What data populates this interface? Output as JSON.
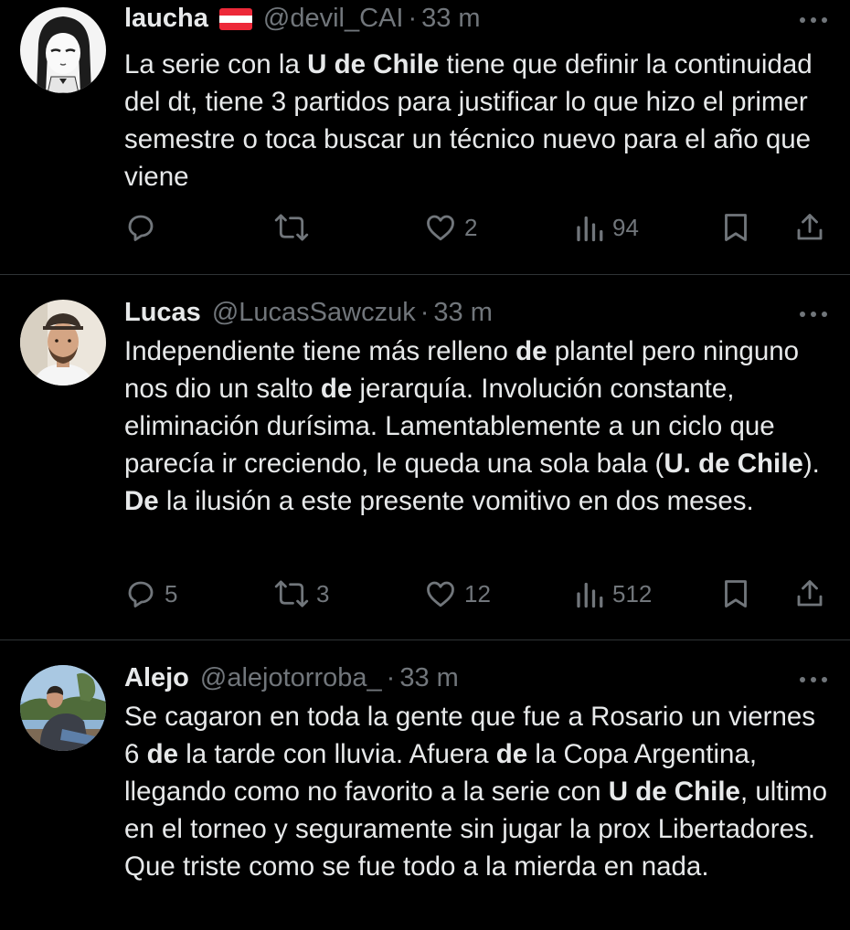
{
  "tweets": [
    {
      "display_name": "laucha",
      "flag": "austria-flag",
      "handle": "@devil_CAI",
      "dot": "·",
      "time": "33 m",
      "body": [
        {
          "t": "La serie con la "
        },
        {
          "t": "U de Chile",
          "b": true
        },
        {
          "t": " tiene que definir la continuidad del dt, tiene 3 partidos para justificar lo que hizo el primer semestre o toca buscar un técnico nuevo para el año que viene"
        }
      ],
      "replies": "",
      "retweets": "",
      "likes": "2",
      "views": "94"
    },
    {
      "display_name": "Lucas",
      "handle": "@LucasSawczuk",
      "dot": "·",
      "time": "33 m",
      "body": [
        {
          "t": "Independiente tiene más relleno "
        },
        {
          "t": "de",
          "b": true
        },
        {
          "t": " plantel pero ninguno nos dio un salto "
        },
        {
          "t": "de",
          "b": true
        },
        {
          "t": " jerarquía. Involución constante, eliminación durísima. Lamentablemente a un ciclo que parecía ir creciendo, le queda una sola bala ("
        },
        {
          "t": "U. de Chile",
          "b": true
        },
        {
          "t": "). "
        },
        {
          "t": "De",
          "b": true
        },
        {
          "t": " la ilusión a este presente vomitivo en dos meses."
        }
      ],
      "replies": "5",
      "retweets": "3",
      "likes": "12",
      "views": "512"
    },
    {
      "display_name": "Alejo",
      "handle": "@alejotorroba_",
      "dot": "·",
      "time": "33 m",
      "body": [
        {
          "t": "Se cagaron en toda la gente que fue a Rosario un viernes 6 "
        },
        {
          "t": "de",
          "b": true
        },
        {
          "t": " la tarde con lluvia. Afuera "
        },
        {
          "t": "de",
          "b": true
        },
        {
          "t": " la Copa Argentina, llegando como no favorito a la serie con "
        },
        {
          "t": "U de Chile",
          "b": true
        },
        {
          "t": ", ultimo en el torneo y seguramente sin jugar la prox Libertadores. Que triste como se fue todo a la mierda en nada."
        }
      ]
    }
  ],
  "icons": {
    "more": "more-options-icon",
    "reply": "reply-icon",
    "retweet": "retweet-icon",
    "like": "heart-icon",
    "views": "views-icon",
    "bookmark": "bookmark-icon",
    "share": "share-icon"
  },
  "colors": {
    "background": "#000000",
    "text": "#e7e9ea",
    "secondary": "#71767b",
    "divider": "#2f3336"
  }
}
